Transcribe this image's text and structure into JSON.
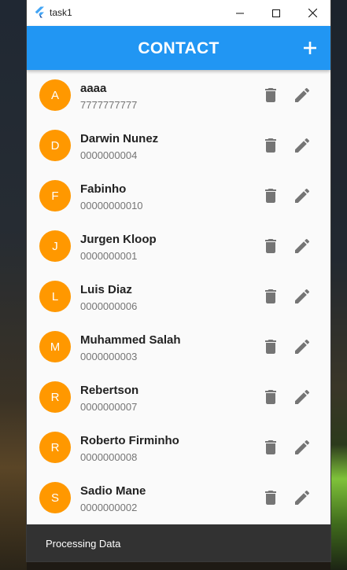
{
  "window": {
    "title": "task1"
  },
  "appbar": {
    "title": "CONTACT",
    "add_icon": "plus-icon",
    "color": "#2196f3"
  },
  "avatar_color": "#ff9800",
  "contacts": [
    {
      "initial": "A",
      "name": "aaaa",
      "phone": "7777777777"
    },
    {
      "initial": "D",
      "name": "Darwin Nunez",
      "phone": "0000000004"
    },
    {
      "initial": "F",
      "name": "Fabinho",
      "phone": "00000000010"
    },
    {
      "initial": "J",
      "name": "Jurgen Kloop",
      "phone": "0000000001"
    },
    {
      "initial": "L",
      "name": "Luis Diaz",
      "phone": "0000000006"
    },
    {
      "initial": "M",
      "name": "Muhammed Salah",
      "phone": "0000000003"
    },
    {
      "initial": "R",
      "name": "Rebertson",
      "phone": "0000000007"
    },
    {
      "initial": "R",
      "name": "Roberto Firminho",
      "phone": "0000000008"
    },
    {
      "initial": "S",
      "name": "Sadio Mane",
      "phone": "0000000002"
    }
  ],
  "row_actions": {
    "delete_icon": "trash-icon",
    "edit_icon": "pencil-icon"
  },
  "snackbar": {
    "text": "Processing Data"
  }
}
